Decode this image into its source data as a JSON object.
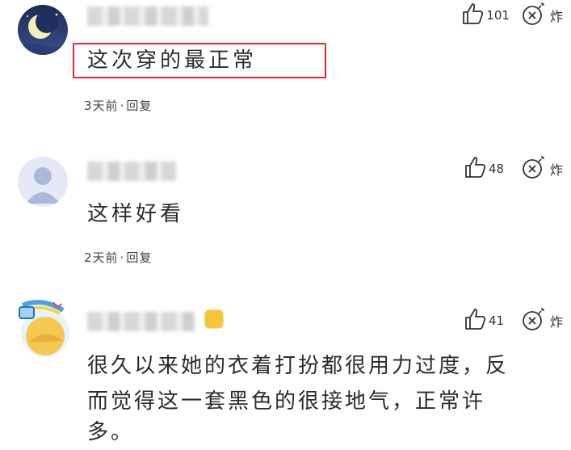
{
  "comments": [
    {
      "username": "",
      "text": "这次穿的最正常",
      "meta_time": "3天前",
      "meta_dot": "·",
      "meta_reply": "回复",
      "likes": "101",
      "bomb_label": "炸",
      "avatar": "moon-avatar"
    },
    {
      "username": "",
      "text": "这样好看",
      "meta_time": "2天前",
      "meta_dot": "·",
      "meta_reply": "回复",
      "likes": "48",
      "bomb_label": "炸",
      "avatar": "default-avatar"
    },
    {
      "username": "",
      "text_line1": "很久以来她的衣着打扮都很用力过度，反",
      "text_line2": "而觉得这一套黑色的很接地气，正常许",
      "text_line3": "多。",
      "likes": "41",
      "bomb_label": "炸",
      "avatar": "cartoon-avatar"
    }
  ],
  "colors": {
    "highlight_border": "#e0262b"
  }
}
